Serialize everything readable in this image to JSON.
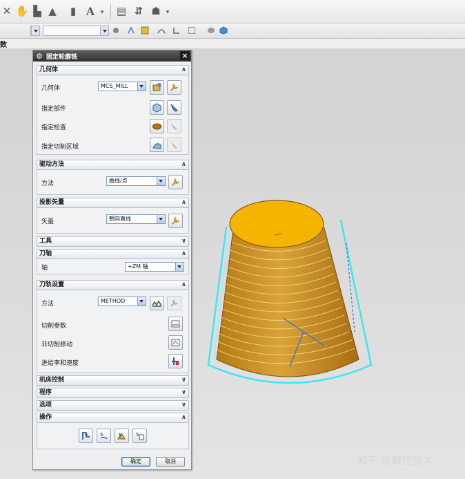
{
  "left_label": "数",
  "dialog": {
    "title": "固定轮廓铣",
    "close_glyph": "×",
    "sections": {
      "geometry": "几何体",
      "drive": "驱动方法",
      "projection": "投影矢量",
      "tool": "工具",
      "tool_axis": "刀轴",
      "path_settings": "刀轨设置",
      "machine_control": "机床控制",
      "program": "程序",
      "options": "选项",
      "actions": "操作"
    },
    "geometry": {
      "geometry_label": "几何体",
      "geometry_value": "MCS_MILL",
      "specify_part": "指定部件",
      "specify_check": "指定检查",
      "specify_cut_area": "指定切削区域"
    },
    "drive": {
      "method_label": "方法",
      "method_value": "曲线/点"
    },
    "projection": {
      "vector_label": "矢量",
      "vector_value": "朝向直线"
    },
    "tool_axis": {
      "axis_label": "轴",
      "axis_value": "+ZM 轴"
    },
    "path_settings": {
      "method_label": "方法",
      "method_value": "METHOD",
      "cut_params": "切削参数",
      "non_cut_moves": "非切削移动",
      "feeds_speeds": "进给率和速度"
    },
    "ok": "确定",
    "cancel": "取消"
  },
  "watermark": "知乎 @数控技术",
  "colors": {
    "title_bar": "#2f2f2f",
    "part_face": "#f5b400",
    "part_side": "#c98a1c",
    "toolpath": "#42e4f0"
  }
}
